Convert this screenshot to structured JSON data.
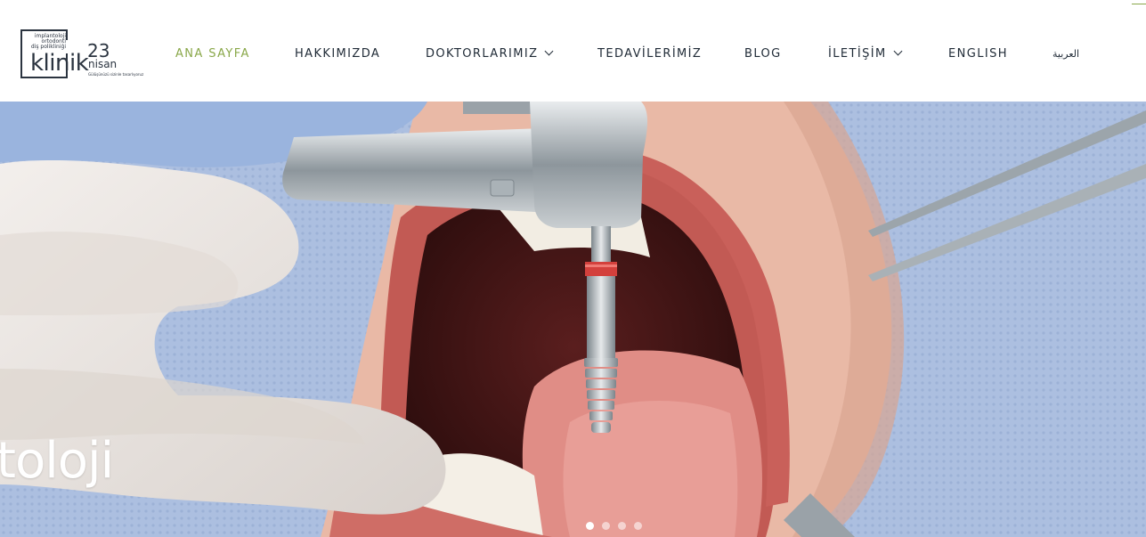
{
  "brand": {
    "line1": "implantoloji",
    "line2": "ortodonti",
    "line3": "diş polikliniği",
    "name": "klinik",
    "number": "23",
    "sub": "nisan",
    "tagline": "Gülüşünüzü sizinle tasarlıyoruz"
  },
  "nav": {
    "items": [
      {
        "label": "ANA SAYFA",
        "active": true
      },
      {
        "label": "HAKKIMIZDA"
      },
      {
        "label": "DOKTORLARIMIZ",
        "dropdown": true
      },
      {
        "label": "TEDAVİLERİMİZ"
      },
      {
        "label": "BLOG"
      },
      {
        "label": "İLETİŞİM",
        "dropdown": true
      },
      {
        "label": "ENGLISH"
      },
      {
        "label": "العربية"
      }
    ]
  },
  "hero": {
    "caption": "toloji",
    "slides_count": 4,
    "active_slide": 1
  },
  "colors": {
    "accent": "#8aa84a",
    "nav_text": "#1f2a36",
    "drape": "#b9c9e6"
  }
}
